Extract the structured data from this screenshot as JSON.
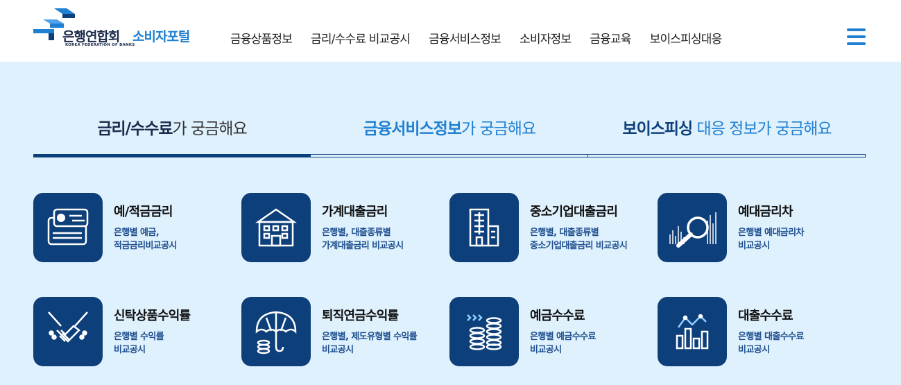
{
  "header": {
    "org_name": "은행연합회",
    "org_english": "KOREA FEDERATION OF BANKS",
    "portal_name": "소비자포털",
    "nav": [
      {
        "label": "금융상품정보"
      },
      {
        "label": "금리/수수료 비교공시"
      },
      {
        "label": "금융서비스정보"
      },
      {
        "label": "소비자정보"
      },
      {
        "label": "금융교육"
      },
      {
        "label": "보이스피싱대응"
      }
    ],
    "menu_icon": "hamburger-menu-icon"
  },
  "tabs": [
    {
      "bold": "금리/수수료",
      "rest": "가 궁금해요",
      "active": true
    },
    {
      "bold": "금융서비스정보",
      "rest": "가 궁금해요",
      "active": false
    },
    {
      "bold": "보이스피싱",
      "rest": " 대응 정보가 궁금해요",
      "active": false
    }
  ],
  "cards": [
    {
      "icon": "card-payment-icon",
      "title": "예/적금금리",
      "desc1": "은행별 예금,",
      "desc2": "적금금리비교공시"
    },
    {
      "icon": "bank-building-icon",
      "title": "가계대출금리",
      "desc1": "은행별, 대출종류별",
      "desc2": "가계대출금리 비교공시"
    },
    {
      "icon": "office-building-icon",
      "title": "중소기업대출금리",
      "desc1": "은행별, 대출종류별",
      "desc2": "중소기업대출금리 비교공시"
    },
    {
      "icon": "magnifier-chart-icon",
      "title": "예대금리차",
      "desc1": "은행별 예대금리차",
      "desc2": "비교공시"
    },
    {
      "icon": "handshake-icon",
      "title": "신탁상품수익률",
      "desc1": "은행별 수익률",
      "desc2": "비교공시"
    },
    {
      "icon": "umbrella-coins-icon",
      "title": "퇴직연금수익률",
      "desc1": "은행별, 제도유형별 수익률",
      "desc2": "비교공시"
    },
    {
      "icon": "coin-stack-icon",
      "title": "예금수수료",
      "desc1": "은행별 예금수수료",
      "desc2": "비교공시"
    },
    {
      "icon": "bar-line-chart-icon",
      "title": "대출수수료",
      "desc1": "은행별 대출수수료",
      "desc2": "비교공시"
    }
  ],
  "colors": {
    "navy": "#0d3f7a",
    "accent": "#1f7fd1",
    "panel_bg": "#dff1fd"
  }
}
